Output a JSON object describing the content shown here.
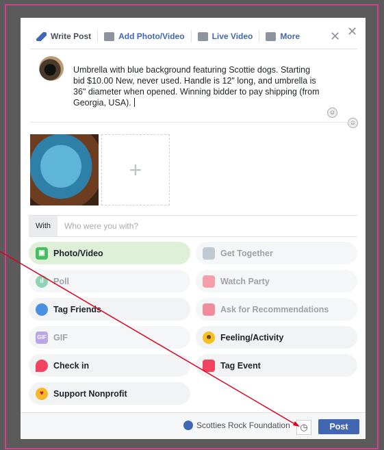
{
  "tabs": [
    "Write Post",
    "Add Photo/Video",
    "Live Video",
    "More"
  ],
  "close_symbol": "✕",
  "post_text": "Umbrella with blue background featuring Scottie dogs. Starting bid $10.00  New, never used. Handle is 12\" long, and umbrella is 36\" diameter when opened.  Winning bidder to pay shipping (from Georgia, USA).",
  "add_photo_symbol": "+",
  "with": {
    "label": "With",
    "placeholder": "Who were you with?"
  },
  "options": [
    "Photo/Video",
    "Get Together",
    "Poll",
    "Watch Party",
    "Tag Friends",
    "Ask for Recommendations",
    "GIF",
    "Feeling/Activity",
    "Check in",
    "Tag Event",
    "Support Nonprofit"
  ],
  "footer": {
    "page_name": "Scotties Rock Foundation",
    "post_label": "Post"
  },
  "colors": {
    "border": "#d83d86",
    "accent": "#4267b2",
    "arrow": "#e0001b",
    "active_option": "#dff0d8"
  },
  "icons": [
    "pencil-icon",
    "photo-icon",
    "video-icon",
    "more-icon",
    "clock-icon",
    "emoji-icon"
  ]
}
